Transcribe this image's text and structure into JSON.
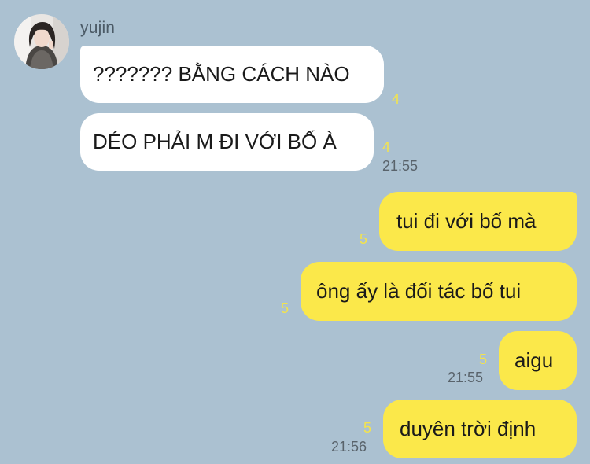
{
  "chat": {
    "sender": {
      "name": "yujin",
      "avatar_icon": "profile-photo"
    },
    "incoming": [
      {
        "text": "??????? BẰNG CÁCH NÀO",
        "unread": "4",
        "time": ""
      },
      {
        "text": "DÉO PHẢI M ĐI VỚI BỐ À",
        "unread": "4",
        "time": "21:55"
      }
    ],
    "outgoing": [
      {
        "text": "tui đi với bố mà",
        "unread": "5",
        "time": ""
      },
      {
        "text": "ông ấy là đối tác bố tui",
        "unread": "5",
        "time": ""
      },
      {
        "text": "aigu",
        "unread": "5",
        "time": "21:55"
      },
      {
        "text": "duyên trời định",
        "unread": "5",
        "time": "21:56"
      }
    ]
  },
  "colors": {
    "background": "#abc1d1",
    "incoming_bubble": "#ffffff",
    "outgoing_bubble": "#fbe84a",
    "unread_count": "#f3e34d",
    "timestamp": "#59636b"
  }
}
